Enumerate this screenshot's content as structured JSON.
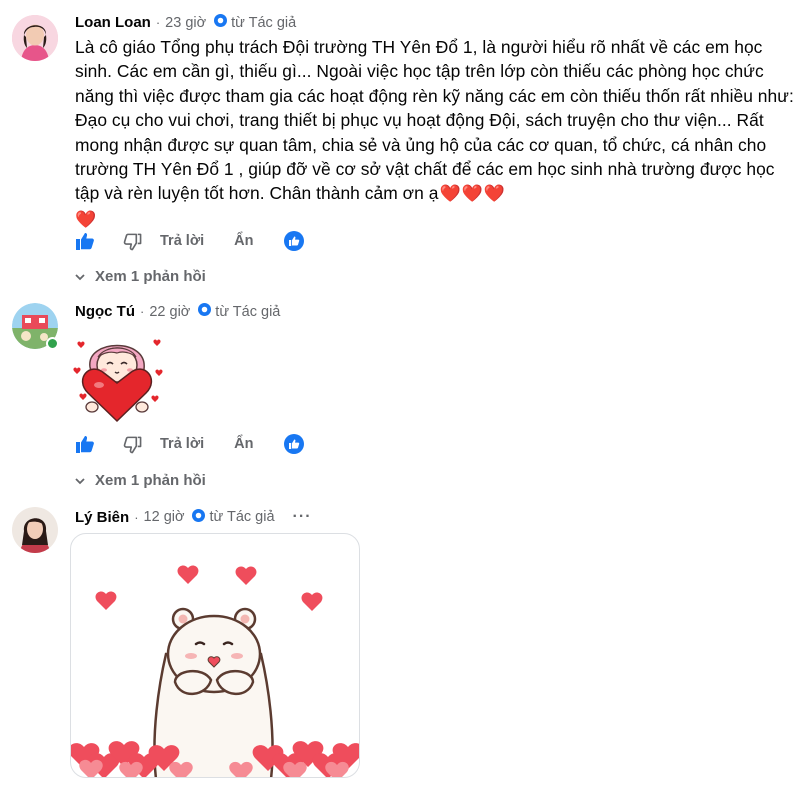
{
  "comments": [
    {
      "author": "Loan Loan",
      "time": "23 giờ",
      "source": "từ Tác giả",
      "text": "Là cô giáo Tổng phụ trách Đội trường TH Yên Đổ 1, là người hiểu rõ nhất về các em học sinh. Các em cần gì, thiếu gì... Ngoài việc học tập trên lớp còn thiếu các phòng học chức năng thì việc được tham gia các hoạt động rèn kỹ năng các em còn thiếu thốn rất nhiều như: Đạo cụ cho vui chơi, trang thiết bị phục vụ hoạt động Đội, sách truyện cho thư viện... Rất mong nhận được sự quan tâm, chia sẻ và ủng hộ của các cơ quan, tổ chức, cá nhân cho trường TH Yên Đổ 1 , giúp đỡ về cơ sở vật chất để các em học sinh nhà trường được học tập và rèn luyện tốt hơn. Chân thành cảm ơn ạ",
      "reply_label": "Trả lời",
      "hide_label": "Ẩn",
      "view_replies": "Xem 1 phản hồi"
    },
    {
      "author": "Ngọc Tú",
      "time": "22 giờ",
      "source": "từ Tác giả",
      "reply_label": "Trả lời",
      "hide_label": "Ẩn",
      "view_replies": "Xem 1 phản hồi"
    },
    {
      "author": "Lý Biên",
      "time": "12 giờ",
      "source": "từ Tác giả",
      "more": "···"
    }
  ],
  "colors": {
    "like_blue": "#1877f2",
    "secondary_text": "#65676b",
    "heart_red": "#e4262c"
  },
  "icons": [
    "like-icon",
    "dislike-icon",
    "reaction-like-icon",
    "chevron-down-icon",
    "author-badge-icon",
    "heart-emoji-icon"
  ]
}
